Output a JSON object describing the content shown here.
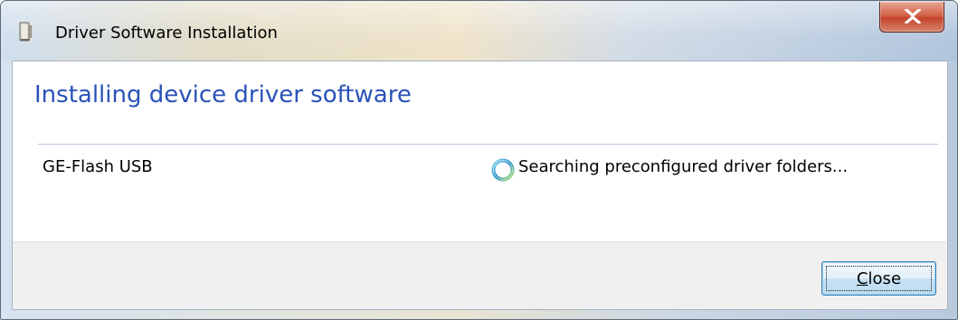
{
  "window": {
    "title": "Driver Software Installation",
    "close_icon": "close-x-icon",
    "app_icon": "driver-install-icon"
  },
  "main": {
    "heading": "Installing device driver software",
    "device": {
      "name": "GE-Flash USB",
      "status": "Searching preconfigured driver folders...",
      "status_icon": "busy-spinner-icon"
    }
  },
  "footer": {
    "close_label_accel": "C",
    "close_label_rest": "lose"
  },
  "colors": {
    "heading": "#2a52b8",
    "close_x_red": "#c4442a",
    "button_border": "#3c7fb1"
  }
}
